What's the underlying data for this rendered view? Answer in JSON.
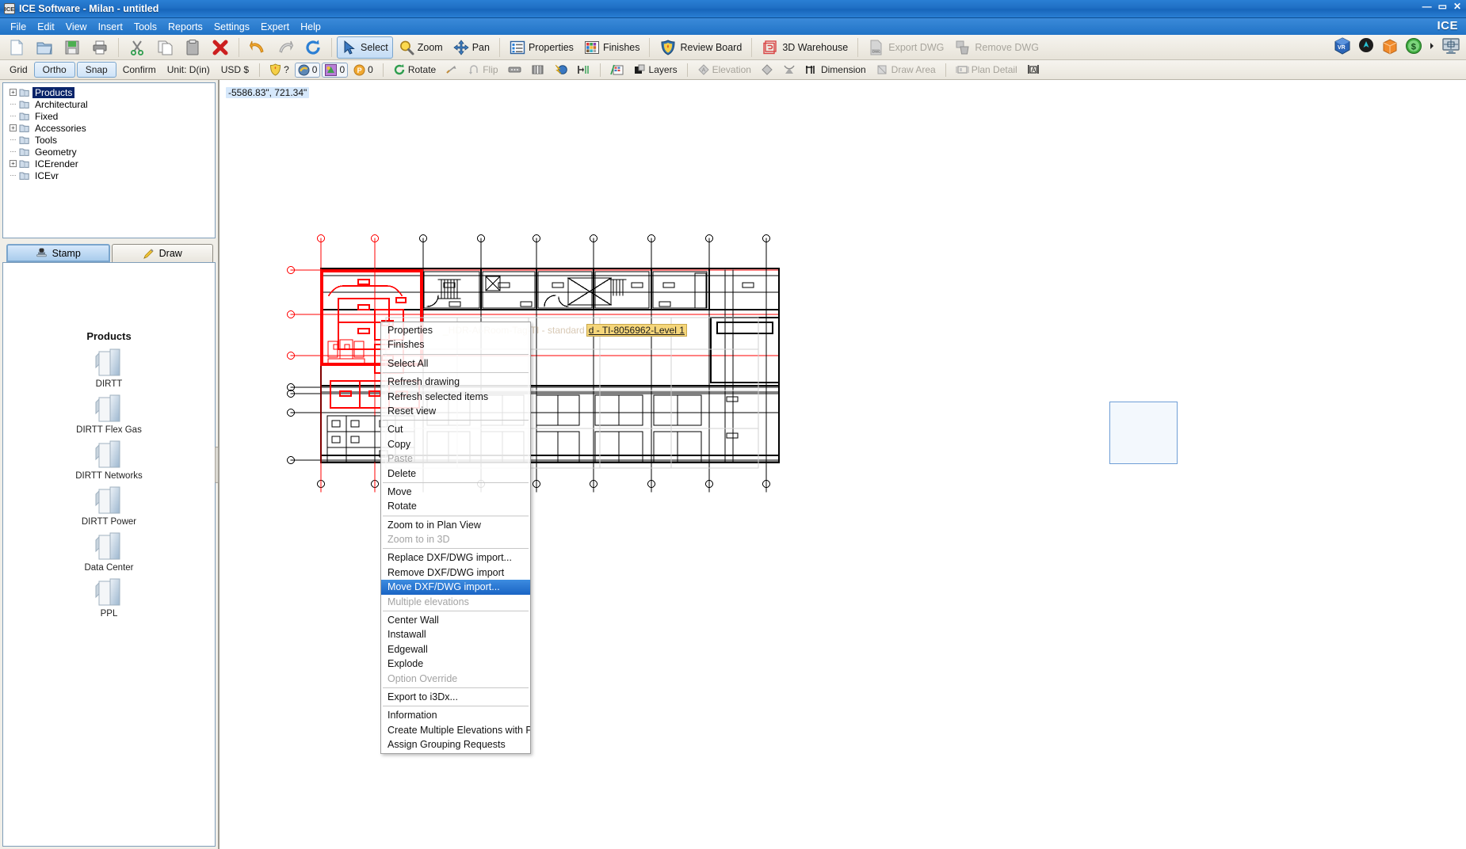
{
  "window": {
    "title": "ICE Software - Milan - untitled",
    "app_icon": "ICE",
    "brand": "ICE",
    "minimize": "—",
    "maximize": "▭",
    "close": "✕"
  },
  "menubar": {
    "items": [
      "File",
      "Edit",
      "View",
      "Insert",
      "Tools",
      "Reports",
      "Settings",
      "Expert",
      "Help"
    ]
  },
  "toolbar1": {
    "buttons": [
      {
        "name": "new",
        "label": "",
        "icon": "new-document-icon",
        "state": "normal"
      },
      {
        "name": "open",
        "label": "",
        "icon": "open-folder-icon",
        "state": "normal"
      },
      {
        "name": "save",
        "label": "",
        "icon": "save-disk-icon",
        "state": "normal"
      },
      {
        "name": "print",
        "label": "",
        "icon": "printer-icon",
        "state": "normal"
      },
      {
        "name": "cut",
        "label": "",
        "icon": "scissors-icon",
        "state": "normal"
      },
      {
        "name": "copy",
        "label": "",
        "icon": "copy-icon",
        "state": "normal"
      },
      {
        "name": "paste",
        "label": "",
        "icon": "clipboard-icon",
        "state": "normal"
      },
      {
        "name": "delete",
        "label": "",
        "icon": "red-x-icon",
        "state": "normal"
      },
      {
        "name": "undo",
        "label": "",
        "icon": "undo-arrow-icon",
        "state": "normal"
      },
      {
        "name": "redo",
        "label": "",
        "icon": "redo-arrow-icon",
        "state": "normal"
      },
      {
        "name": "refresh",
        "label": "",
        "icon": "refresh-icon",
        "state": "normal"
      },
      {
        "name": "select",
        "label": "Select",
        "icon": "cursor-arrow-icon",
        "state": "pressed"
      },
      {
        "name": "zoom",
        "label": "Zoom",
        "icon": "magnifier-icon",
        "state": "normal"
      },
      {
        "name": "pan",
        "label": "Pan",
        "icon": "pan-arrows-icon",
        "state": "normal"
      },
      {
        "name": "properties",
        "label": "Properties",
        "icon": "list-properties-icon",
        "state": "normal"
      },
      {
        "name": "finishes",
        "label": "Finishes",
        "icon": "color-swatches-icon",
        "state": "normal"
      },
      {
        "name": "review-board",
        "label": "Review Board",
        "icon": "shield-board-icon",
        "state": "normal"
      },
      {
        "name": "3d-warehouse",
        "label": "3D Warehouse",
        "icon": "warehouse-3d-icon",
        "state": "normal"
      },
      {
        "name": "export-dwg",
        "label": "Export DWG",
        "icon": "export-dwg-icon",
        "state": "disabled"
      },
      {
        "name": "remove-dwg",
        "label": "Remove DWG",
        "icon": "remove-dwg-icon",
        "state": "disabled"
      }
    ],
    "right_icons": [
      {
        "name": "vr-view",
        "icon": "vr-cube-icon",
        "label": "VR"
      },
      {
        "name": "location-pin",
        "icon": "location-pin-icon",
        "label": ""
      },
      {
        "name": "box-render",
        "icon": "orange-box-icon",
        "label": ""
      },
      {
        "name": "pricing",
        "icon": "dollar-coin-icon",
        "label": "$"
      },
      {
        "name": "overflow",
        "icon": "chevron-right-icon",
        "label": "▸"
      },
      {
        "name": "monitor-view",
        "icon": "monitor-icon",
        "label": ""
      }
    ]
  },
  "toolbar2": {
    "grid_label": "Grid",
    "ortho_label": "Ortho",
    "snap_label": "Snap",
    "confirm_label": "Confirm",
    "unit_label": "Unit: D(in)",
    "currency_label": "USD $",
    "shield_help": "?",
    "counters": [
      {
        "name": "counter-layers",
        "icon": "ring-icon",
        "value": "0"
      },
      {
        "name": "counter-finishes",
        "icon": "palette-icon",
        "value": "0"
      },
      {
        "name": "counter-points",
        "icon": "p-circle-icon",
        "value": "0"
      }
    ],
    "rotate_label": "Rotate",
    "flip_label": "Flip",
    "layers_label": "Layers",
    "elevation_label": "Elevation",
    "dimension_label": "Dimension",
    "draw_area_label": "Draw Area",
    "plan_detail_label": "Plan Detail",
    "states": {
      "ortho": "on",
      "snap": "on",
      "flip": "disabled",
      "elevation": "disabled",
      "draw_area": "disabled",
      "plan_detail": "disabled"
    }
  },
  "sidebar": {
    "tree": [
      {
        "label": "Products",
        "expandable": true,
        "selected": true,
        "indent": 0
      },
      {
        "label": "Architectural",
        "expandable": false,
        "selected": false,
        "indent": 0
      },
      {
        "label": "Fixed",
        "expandable": false,
        "selected": false,
        "indent": 0
      },
      {
        "label": "Accessories",
        "expandable": true,
        "selected": false,
        "indent": 0
      },
      {
        "label": "Tools",
        "expandable": false,
        "selected": false,
        "indent": 0
      },
      {
        "label": "Geometry",
        "expandable": false,
        "selected": false,
        "indent": 0
      },
      {
        "label": "ICErender",
        "expandable": true,
        "selected": false,
        "indent": 0
      },
      {
        "label": "ICEvr",
        "expandable": false,
        "selected": false,
        "indent": 0
      }
    ],
    "tabs": [
      {
        "label": "Stamp",
        "icon": "stamp-icon",
        "active": true
      },
      {
        "label": "Draw",
        "icon": "pencil-icon",
        "active": false
      }
    ],
    "palette_title": "Products",
    "palette_items": [
      {
        "label": "DIRTT",
        "icon": "folder-icon"
      },
      {
        "label": "DIRTT Flex Gas",
        "icon": "folder-icon"
      },
      {
        "label": "DIRTT Networks",
        "icon": "folder-icon"
      },
      {
        "label": "DIRTT Power",
        "icon": "folder-icon"
      },
      {
        "label": "Data Center",
        "icon": "folder-icon"
      },
      {
        "label": "PPL",
        "icon": "folder-icon"
      }
    ]
  },
  "canvas": {
    "coordinate_readout": "-5586.83\", 721.34\"",
    "room_tag_dim": "_HDR-Ai-Room-Tag-TI - standard",
    "room_tag_hot": "d - TI-8056962-Level 1"
  },
  "context_menu": {
    "items": [
      {
        "label": "Properties",
        "state": "normal",
        "sep_after": false
      },
      {
        "label": "Finishes",
        "state": "normal",
        "sep_after": true
      },
      {
        "label": "Select All",
        "state": "normal",
        "sep_after": true
      },
      {
        "label": "Refresh drawing",
        "state": "normal",
        "sep_after": false
      },
      {
        "label": "Refresh selected items",
        "state": "normal",
        "sep_after": false
      },
      {
        "label": "Reset view",
        "state": "normal",
        "sep_after": true
      },
      {
        "label": "Cut",
        "state": "normal",
        "sep_after": false
      },
      {
        "label": "Copy",
        "state": "normal",
        "sep_after": false
      },
      {
        "label": "Paste",
        "state": "disabled",
        "sep_after": false
      },
      {
        "label": "Delete",
        "state": "normal",
        "sep_after": true
      },
      {
        "label": "Move",
        "state": "normal",
        "sep_after": false
      },
      {
        "label": "Rotate",
        "state": "normal",
        "sep_after": true
      },
      {
        "label": "Zoom to in Plan View",
        "state": "normal",
        "sep_after": false
      },
      {
        "label": "Zoom to in 3D",
        "state": "disabled",
        "sep_after": true
      },
      {
        "label": "Replace DXF/DWG import...",
        "state": "normal",
        "sep_after": false
      },
      {
        "label": "Remove DXF/DWG import",
        "state": "normal",
        "sep_after": false
      },
      {
        "label": "Move DXF/DWG import...",
        "state": "selected",
        "sep_after": false
      },
      {
        "label": "Multiple elevations",
        "state": "disabled",
        "sep_after": true
      },
      {
        "label": "Center Wall",
        "state": "normal",
        "sep_after": false
      },
      {
        "label": "Instawall",
        "state": "normal",
        "sep_after": false
      },
      {
        "label": "Edgewall",
        "state": "normal",
        "sep_after": false
      },
      {
        "label": "Explode",
        "state": "normal",
        "sep_after": false
      },
      {
        "label": "Option Override",
        "state": "disabled",
        "sep_after": true
      },
      {
        "label": "Export to i3Dx...",
        "state": "normal",
        "sep_after": true
      },
      {
        "label": "Information",
        "state": "normal",
        "sep_after": false
      },
      {
        "label": "Create Multiple Elevations with Plan Details",
        "state": "normal",
        "sep_after": false
      },
      {
        "label": "Assign Grouping Requests",
        "state": "normal",
        "sep_after": false
      }
    ]
  },
  "colors": {
    "title_blue": "#1f6fc4",
    "selection_blue": "#0a246a",
    "menu_highlight": "#1a64c4",
    "drawing_red": "#ff0000",
    "drawing_black": "#000000",
    "tag_yellow": "#f5d67a",
    "toolbar_bg": "#efece4"
  }
}
